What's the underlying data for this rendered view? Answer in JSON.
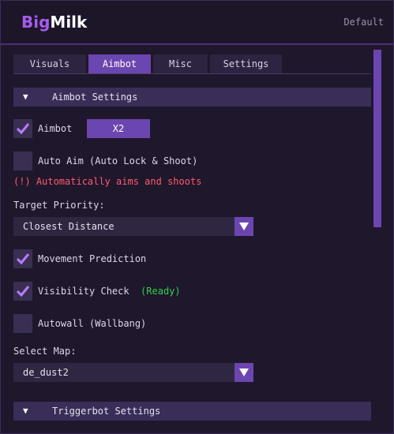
{
  "header": {
    "brand_part1": "Big",
    "brand_part2": "Milk",
    "profile": "Default"
  },
  "tabs": [
    {
      "label": "Visuals"
    },
    {
      "label": "Aimbot"
    },
    {
      "label": "Misc"
    },
    {
      "label": "Settings"
    }
  ],
  "active_tab": "Aimbot",
  "aimbot_section": {
    "title": "Aimbot Settings",
    "aimbot": {
      "label": "Aimbot",
      "checked": true,
      "keybind": "X2"
    },
    "auto_aim": {
      "label": "Auto Aim (Auto Lock & Shoot)",
      "checked": false
    },
    "warning": "(!) Automatically aims and shoots",
    "target_priority": {
      "label": "Target Priority:",
      "value": "Closest Distance"
    },
    "movement_prediction": {
      "label": "Movement Prediction",
      "checked": true
    },
    "visibility_check": {
      "label": "Visibility Check",
      "checked": true,
      "status": "(Ready)"
    },
    "autowall": {
      "label": "Autowall (Wallbang)",
      "checked": false
    },
    "select_map": {
      "label": "Select Map:",
      "value": "de_dust2"
    }
  },
  "triggerbot_section": {
    "title": "Triggerbot Settings"
  },
  "colors": {
    "accent": "#6c46b0",
    "brand_purple": "#a55cf0",
    "warning": "#ff5a6e",
    "ready": "#2fd24a"
  }
}
